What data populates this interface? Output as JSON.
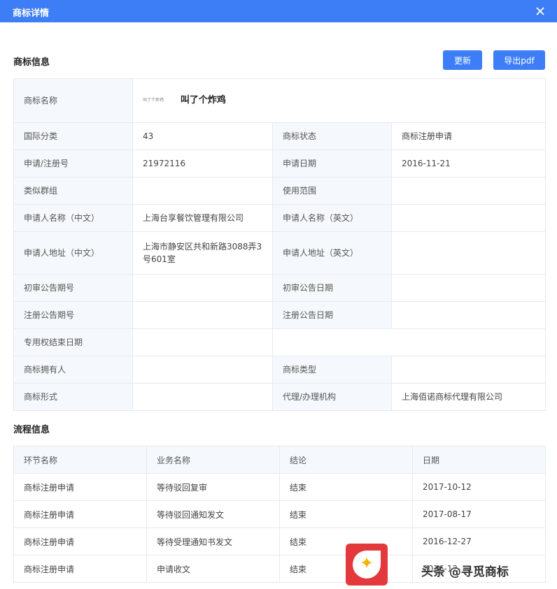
{
  "dialog": {
    "title": "商标详情"
  },
  "section_info": {
    "title": "商标信息",
    "refresh_label": "更新",
    "export_label": "导出pdf"
  },
  "trademark": {
    "thumb_text": "叫了个炸鸡",
    "name": "叫了个炸鸡"
  },
  "info": {
    "name_label": "商标名称",
    "rows": [
      {
        "l1": "国际分类",
        "v1": "43",
        "l2": "商标状态",
        "v2": "商标注册申请"
      },
      {
        "l1": "申请/注册号",
        "v1": "21972116",
        "l2": "申请日期",
        "v2": "2016-11-21"
      },
      {
        "l1": "类似群组",
        "v1": "",
        "l2": "使用范围",
        "v2": ""
      },
      {
        "l1": "申请人名称（中文）",
        "v1": "上海台享餐饮管理有限公司",
        "l2": "申请人名称（英文）",
        "v2": ""
      },
      {
        "l1": "申请人地址（中文）",
        "v1": "上海市静安区共和新路3088弄3号601室",
        "l2": "申请人地址（英文）",
        "v2": ""
      },
      {
        "l1": "初审公告期号",
        "v1": "",
        "l2": "初审公告日期",
        "v2": ""
      },
      {
        "l1": "注册公告期号",
        "v1": "",
        "l2": "注册公告日期",
        "v2": ""
      }
    ],
    "exclusive_end_label": "专用权结束日期",
    "exclusive_end_value": "",
    "rows2": [
      {
        "l1": "商标拥有人",
        "v1": "",
        "l2": "商标类型",
        "v2": ""
      },
      {
        "l1": "商标形式",
        "v1": "",
        "l2": "代理/办理机构",
        "v2": "上海佰诺商标代理有限公司"
      }
    ]
  },
  "section_flow": {
    "title": "流程信息"
  },
  "flow": {
    "headers": [
      "环节名称",
      "业务名称",
      "结论",
      "日期"
    ],
    "rows": [
      [
        "商标注册申请",
        "等待驳回复审",
        "结束",
        "2017-10-12"
      ],
      [
        "商标注册申请",
        "等待驳回通知发文",
        "结束",
        "2017-08-17"
      ],
      [
        "商标注册申请",
        "等待受理通知书发文",
        "结束",
        "2016-12-27"
      ],
      [
        "商标注册申请",
        "申请收文",
        "结束",
        "2016-12-"
      ]
    ]
  },
  "watermark": {
    "text": "头条 @寻觅商标"
  }
}
